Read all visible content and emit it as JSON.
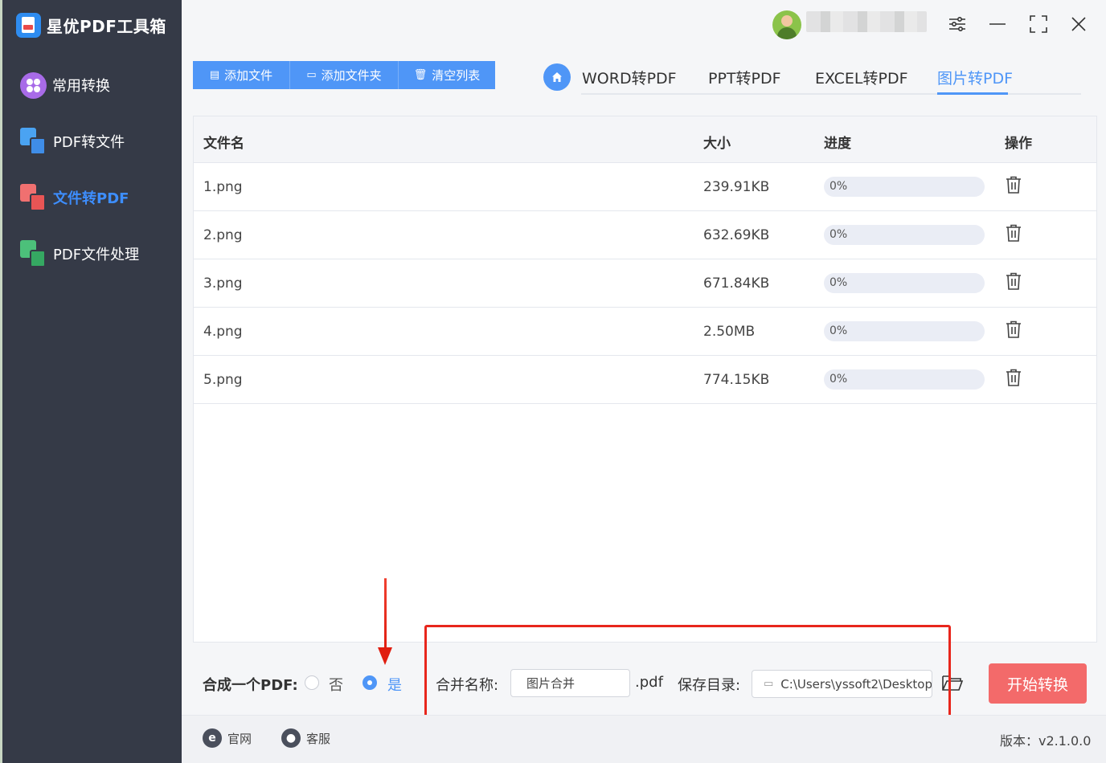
{
  "app": {
    "title": "星优PDF工具箱"
  },
  "sidebar": {
    "items": [
      {
        "label": "常用转换"
      },
      {
        "label": "PDF转文件"
      },
      {
        "label": "文件转PDF"
      },
      {
        "label": "PDF文件处理"
      }
    ],
    "active_index": 2
  },
  "toolbar": {
    "add_file": "添加文件",
    "add_folder": "添加文件夹",
    "clear_list": "清空列表"
  },
  "tabs": [
    {
      "label": "WORD转PDF"
    },
    {
      "label": "PPT转PDF"
    },
    {
      "label": "EXCEL转PDF"
    },
    {
      "label": "图片转PDF"
    }
  ],
  "active_tab": 3,
  "table": {
    "headers": {
      "name": "文件名",
      "size": "大小",
      "progress": "进度",
      "action": "操作"
    },
    "rows": [
      {
        "name": "1.png",
        "size": "239.91KB",
        "progress_text": "0%",
        "progress": 0
      },
      {
        "name": "2.png",
        "size": "632.69KB",
        "progress_text": "0%",
        "progress": 0
      },
      {
        "name": "3.png",
        "size": "671.84KB",
        "progress_text": "0%",
        "progress": 0
      },
      {
        "name": "4.png",
        "size": "2.50MB",
        "progress_text": "0%",
        "progress": 0
      },
      {
        "name": "5.png",
        "size": "774.15KB",
        "progress_text": "0%",
        "progress": 0
      }
    ]
  },
  "options": {
    "merge_label": "合成一个PDF:",
    "no_label": "否",
    "yes_label": "是",
    "merge_selected": "yes",
    "merge_name_label": "合并名称:",
    "merge_name_value": "图片合并",
    "extension": ".pdf",
    "save_dir_label": "保存目录:",
    "save_dir_value": "C:\\Users\\yssoft2\\Desktop"
  },
  "start_button": "开始转换",
  "footer": {
    "website": "官网",
    "support": "客服",
    "version": "版本：v2.1.0.0"
  },
  "colors": {
    "accent": "#4f96f7",
    "sidebar_bg": "#353a47",
    "start_button": "#f36a6a",
    "highlight_box": "#e8261c"
  }
}
